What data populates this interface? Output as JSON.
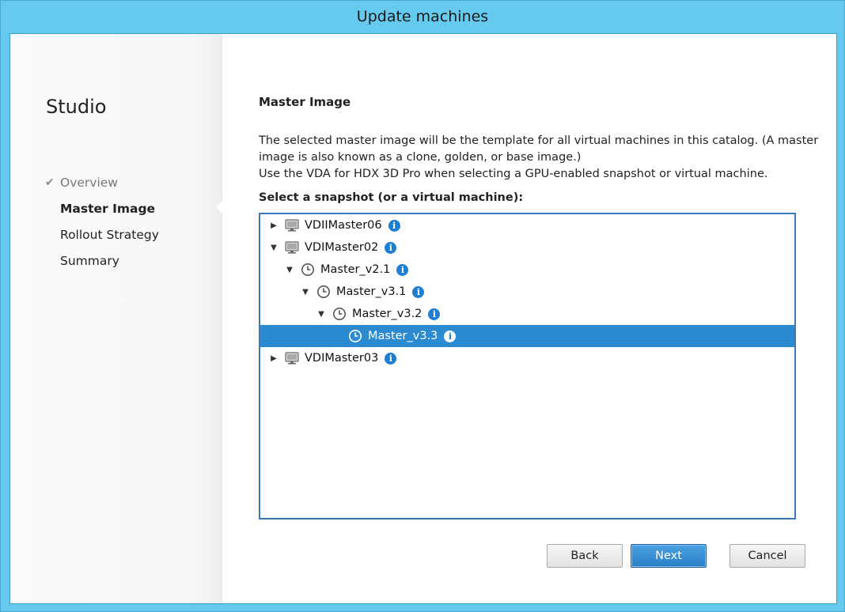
{
  "window": {
    "title": "Update machines"
  },
  "sidebar": {
    "brand": "Studio",
    "items": [
      {
        "label": "Overview",
        "state": "done"
      },
      {
        "label": "Master Image",
        "state": "active"
      },
      {
        "label": "Rollout Strategy",
        "state": "pending"
      },
      {
        "label": "Summary",
        "state": "pending"
      }
    ]
  },
  "main": {
    "heading": "Master Image",
    "description": [
      "The selected master image will be the template for all virtual machines in this catalog. (A master",
      "image is also known as a clone, golden, or base image.)",
      "Use the VDA for HDX 3D Pro when selecting a GPU-enabled snapshot or virtual machine."
    ],
    "select_label": "Select a snapshot (or a virtual machine):",
    "tree": [
      {
        "label": "VDIIMaster06",
        "type": "vm",
        "level": 0,
        "expander": "collapsed",
        "selected": false
      },
      {
        "label": "VDIMaster02",
        "type": "vm",
        "level": 0,
        "expander": "expanded",
        "selected": false
      },
      {
        "label": "Master_v2.1",
        "type": "snapshot",
        "level": 1,
        "expander": "expanded",
        "selected": false
      },
      {
        "label": "Master_v3.1",
        "type": "snapshot",
        "level": 2,
        "expander": "expanded",
        "selected": false
      },
      {
        "label": "Master_v3.2",
        "type": "snapshot",
        "level": 3,
        "expander": "expanded",
        "selected": false
      },
      {
        "label": "Master_v3.3",
        "type": "snapshot",
        "level": 4,
        "expander": "none",
        "selected": true
      },
      {
        "label": "VDIMaster03",
        "type": "vm",
        "level": 0,
        "expander": "collapsed",
        "selected": false
      }
    ]
  },
  "buttons": {
    "back": "Back",
    "next": "Next",
    "cancel": "Cancel"
  },
  "colors": {
    "selection": "#2b8ad0",
    "frame": "#66c9ee",
    "info": "#1e7fd0"
  }
}
